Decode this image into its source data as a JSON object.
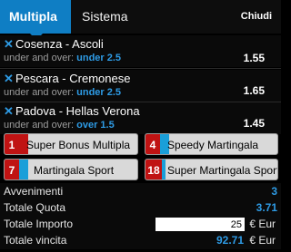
{
  "tabs": {
    "multipla": "Multipla",
    "sistema": "Sistema",
    "close": "Chiudi"
  },
  "bets": [
    {
      "match": "Cosenza - Ascoli",
      "market": "under and over:",
      "selection": "under 2.5",
      "odd": "1.55"
    },
    {
      "match": "Pescara - Cremonese",
      "market": "under and over:",
      "selection": "under 2.5",
      "odd": "1.65"
    },
    {
      "match": "Padova - Hellas Verona",
      "market": "under and over:",
      "selection": "over 1.5",
      "odd": "1.45"
    }
  ],
  "promos": [
    {
      "num": "1",
      "label": "Super Bonus Multipla",
      "color": "#c01313"
    },
    {
      "num": "4",
      "label": "Speedy Martingala",
      "color": "#1a9fd9"
    },
    {
      "num": "7",
      "label": "Martingala Sport",
      "color": "#1a9fd9"
    },
    {
      "num": "18",
      "label": "Super Martingala Sport",
      "color": "#1a9fd9"
    }
  ],
  "summary": {
    "avvenimenti_label": "Avvenimenti",
    "avvenimenti": "3",
    "quota_label": "Totale Quota",
    "quota": "3.71",
    "importo_label": "Totale Importo",
    "importo": "25",
    "currency": "€ Eur",
    "vincita_label": "Totale vincita",
    "vincita": "92.71"
  },
  "colors": {
    "accent": "#0f7ec4",
    "selection": "#2e9be5",
    "promo_red": "#c01313"
  }
}
